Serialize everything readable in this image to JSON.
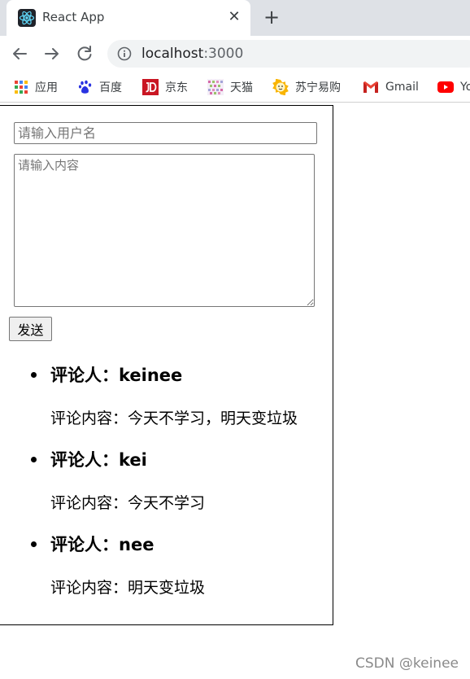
{
  "browser": {
    "tab": {
      "title": "React App",
      "close_glyph": "✕"
    },
    "newtab_glyph": "+",
    "url": {
      "host": "localhost",
      "port": ":3000"
    },
    "bookmarks": [
      {
        "label": "应用",
        "icon": "apps-grid-icon"
      },
      {
        "label": "百度",
        "icon": "baidu-paw-icon"
      },
      {
        "label": "京东",
        "icon": "jd-logo-icon"
      },
      {
        "label": "天猫",
        "icon": "tmall-logo-icon"
      },
      {
        "label": "苏宁易购",
        "icon": "suning-logo-icon"
      },
      {
        "label": "Gmail",
        "icon": "gmail-logo-icon"
      },
      {
        "label": "Yo",
        "icon": "youtube-logo-icon"
      }
    ]
  },
  "form": {
    "username_placeholder": "请输入用户名",
    "content_placeholder": "请输入内容",
    "send_label": "发送"
  },
  "comments": [
    {
      "author": "评论人：keinee",
      "content": "评论内容：今天不学习，明天变垃圾"
    },
    {
      "author": "评论人：kei",
      "content": "评论内容：今天不学习"
    },
    {
      "author": "评论人：nee",
      "content": "评论内容：明天变垃圾"
    }
  ],
  "watermark": "CSDN @keinee",
  "colors": {
    "tabstrip": "#dee1e6",
    "omnibox": "#f1f3f4",
    "react_blue": "#61dafb",
    "jd_red": "#c91623",
    "baidu_blue": "#2932e1",
    "suning_yellow": "#f9b400",
    "youtube_red": "#ff0000"
  }
}
